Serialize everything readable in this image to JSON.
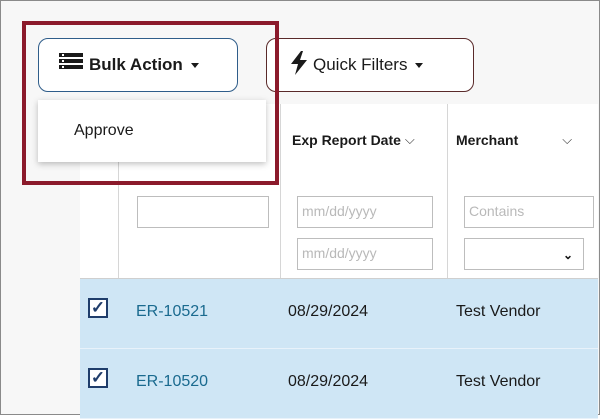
{
  "toolbar": {
    "bulk_action_label": "Bulk Action",
    "quick_filters_label": "Quick Filters"
  },
  "bulk_menu": {
    "items": [
      "Approve"
    ]
  },
  "table": {
    "headers": [
      "",
      "Exp Report Date",
      "Merchant"
    ],
    "filters": {
      "exp_report_date_from_placeholder": "mm/dd/yyyy",
      "exp_report_date_to_placeholder": "mm/dd/yyyy",
      "merchant_placeholder": "Contains"
    },
    "rows": [
      {
        "checked": true,
        "id": "ER-10521",
        "exp_report_date": "08/29/2024",
        "merchant": "Test Vendor"
      },
      {
        "checked": true,
        "id": "ER-10520",
        "exp_report_date": "08/29/2024",
        "merchant": "Test Vendor"
      }
    ]
  },
  "colors": {
    "selected_row": "#cfe6f5",
    "link": "#1a6a8f",
    "highlight_border": "#8b1a2b"
  }
}
